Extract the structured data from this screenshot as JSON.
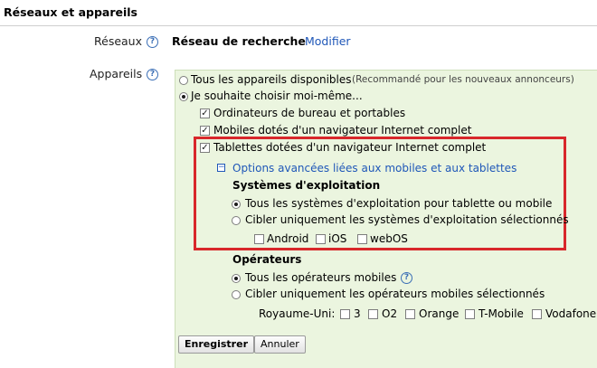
{
  "section_title": "Réseaux et appareils",
  "networks": {
    "label": "Réseaux",
    "help": "?",
    "value": "Réseau de recherche",
    "modify_link": "Modifier"
  },
  "devices": {
    "label": "Appareils",
    "help": "?",
    "option_all": "Tous les appareils disponibles",
    "option_all_hint": "(Recommandé pour les nouveaux annonceurs)",
    "option_choose": "Je souhaite choisir moi-même...",
    "desktop": "Ordinateurs de bureau et portables",
    "mobile": "Mobiles dotés d'un navigateur Internet complet",
    "tablets": "Tablettes dotées d'un navigateur Internet complet",
    "advanced_toggle": "Options avancées liées aux mobiles et aux tablettes",
    "os_heading": "Systèmes d'exploitation",
    "os_all": "Tous les systèmes d'exploitation pour tablette ou mobile",
    "os_select": "Cibler uniquement les systèmes d'exploitation sélectionnés",
    "os_options": [
      "Android",
      "iOS",
      "webOS"
    ],
    "operators_heading": "Opérateurs",
    "operators_all": "Tous les opérateurs mobiles",
    "operators_help": "?",
    "operators_select": "Cibler uniquement les opérateurs mobiles sélectionnés",
    "country": "Royaume-Uni:",
    "carriers": [
      "3",
      "O2",
      "Orange",
      "T-Mobile",
      "Vodafone"
    ]
  },
  "buttons": {
    "save": "Enregistrer",
    "cancel": "Annuler"
  },
  "glyphs": {
    "check": "✓",
    "collapse": "−"
  }
}
